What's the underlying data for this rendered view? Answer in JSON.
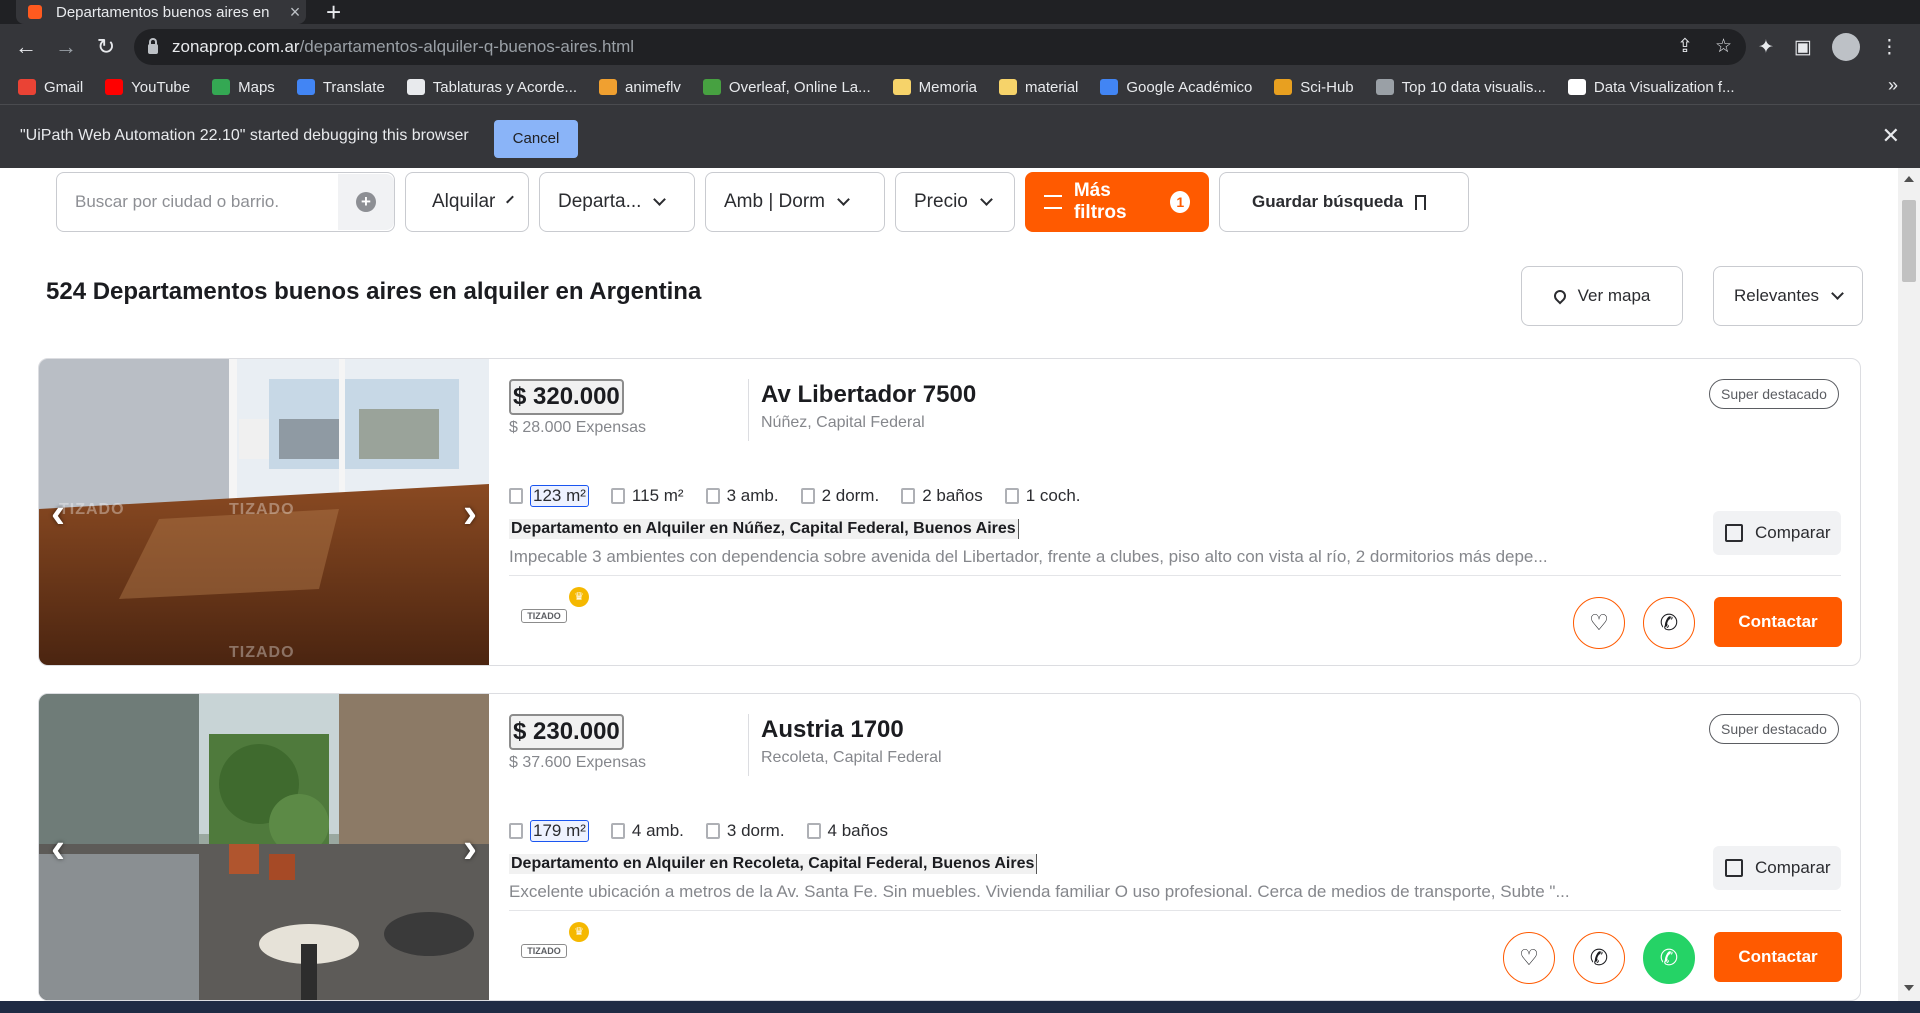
{
  "browser": {
    "tab_title": "Departamentos buenos aires en",
    "url_domain": "zonaprop.com.ar",
    "url_path": "/departamentos-alquiler-q-buenos-aires.html",
    "bookmarks": [
      {
        "label": "Gmail",
        "icon": "gmail-icon",
        "color": "#ea4335"
      },
      {
        "label": "YouTube",
        "icon": "youtube-icon",
        "color": "#ff0000"
      },
      {
        "label": "Maps",
        "icon": "maps-icon",
        "color": "#34a853"
      },
      {
        "label": "Translate",
        "icon": "translate-icon",
        "color": "#4285f4"
      },
      {
        "label": "Tablaturas y Acorde...",
        "icon": "guitar-icon",
        "color": "#e8eaed"
      },
      {
        "label": "animeflv",
        "icon": "animeflv-icon",
        "color": "#f0a030"
      },
      {
        "label": "Overleaf, Online La...",
        "icon": "overleaf-icon",
        "color": "#47a141"
      },
      {
        "label": "Memoria",
        "icon": "folder-icon",
        "color": "#f6d36a"
      },
      {
        "label": "material",
        "icon": "folder-icon",
        "color": "#f6d36a"
      },
      {
        "label": "Google Académico",
        "icon": "scholar-icon",
        "color": "#4285f4"
      },
      {
        "label": "Sci-Hub",
        "icon": "scihub-icon",
        "color": "#e8a020"
      },
      {
        "label": "Top 10 data visualis...",
        "icon": "globe-icon",
        "color": "#9aa0a6"
      },
      {
        "label": "Data Visualization f...",
        "icon": "notion-icon",
        "color": "#ffffff"
      }
    ],
    "bookmarks_more": "»",
    "infobar_text": "\"UiPath Web Automation 22.10\" started debugging this browser",
    "infobar_cancel": "Cancel"
  },
  "filters": {
    "search_placeholder": "Buscar por ciudad o barrio.",
    "operation": "Alquilar",
    "property_type": "Departa...",
    "rooms": "Amb | Dorm",
    "price": "Precio",
    "more_filters": "Más filtros",
    "more_filters_count": "1",
    "save_search": "Guardar búsqueda"
  },
  "results": {
    "title": "524 Departamentos buenos aires en alquiler en Argentina",
    "map_button": "Ver mapa",
    "sort": "Relevantes"
  },
  "listings": [
    {
      "price": "$ 320.000",
      "expenses": "$ 28.000 Expensas",
      "address": "Av Libertador 7500",
      "location": "Núñez, Capital Federal",
      "badge": "Super destacado",
      "features": [
        "123 m²",
        "115 m²",
        "3 amb.",
        "2 dorm.",
        "2 baños",
        "1 coch."
      ],
      "title": "Departamento en Alquiler en Núñez, Capital Federal, Buenos Aires",
      "description": "Impecable 3 ambientes con dependencia sobre avenida del Libertador, frente a clubes, piso alto con vista al río, 2 dormitorios más depe...",
      "compare": "Comparar",
      "contact": "Contactar",
      "publisher": "TIZADO"
    },
    {
      "price": "$ 230.000",
      "expenses": "$ 37.600 Expensas",
      "address": "Austria 1700",
      "location": "Recoleta, Capital Federal",
      "badge": "Super destacado",
      "features": [
        "179 m²",
        "4 amb.",
        "3 dorm.",
        "4 baños"
      ],
      "title": "Departamento en Alquiler en Recoleta, Capital Federal, Buenos Aires",
      "description": "Excelente ubicación a metros de la Av. Santa Fe. Sin muebles. Vivienda familiar O uso profesional. Cerca de medios de transporte, Subte \"...",
      "compare": "Comparar",
      "contact": "Contactar",
      "publisher": "TIZADO"
    }
  ],
  "colors": {
    "accent": "#ff5a00",
    "chrome_dark": "#202124",
    "chrome": "#35363a",
    "infobar_button": "#8ab4f8",
    "whatsapp": "#25d366"
  }
}
